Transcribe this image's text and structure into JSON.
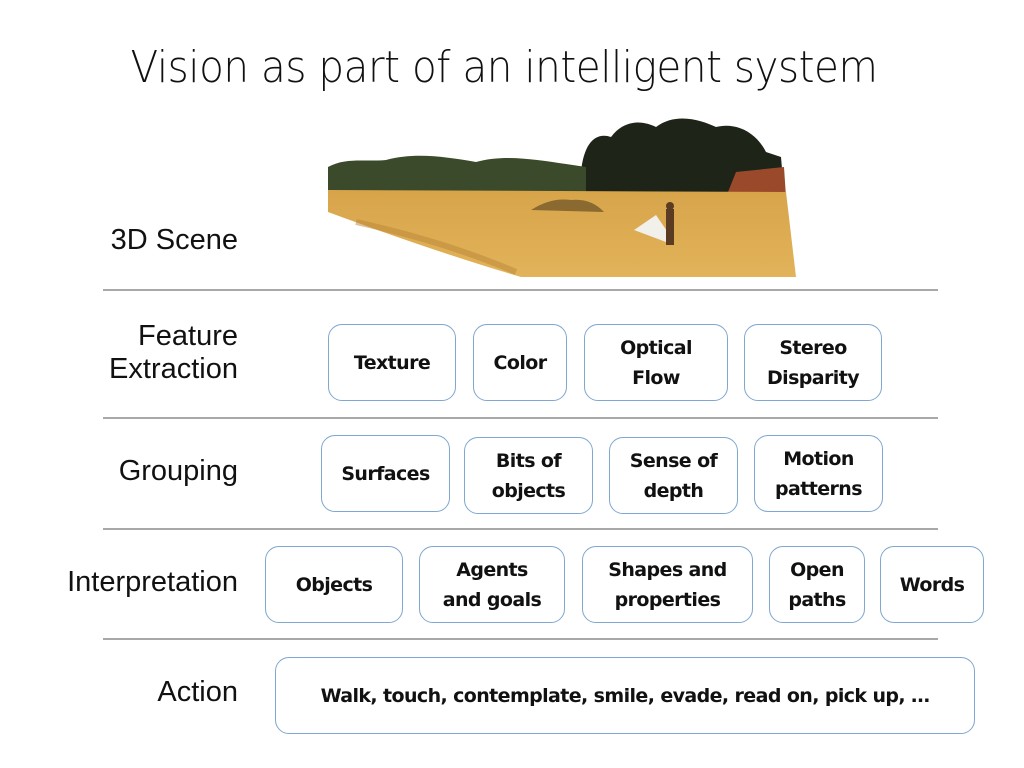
{
  "title": "Vision as part of an intelligent system",
  "layers": {
    "scene": {
      "label": "3D Scene",
      "image": "field-scene-with-trees-and-person"
    },
    "feature": {
      "label": "Feature\nExtraction",
      "items": [
        "Texture",
        "Color",
        "Optical\nFlow",
        "Stereo\nDisparity"
      ]
    },
    "grouping": {
      "label": "Grouping",
      "items": [
        "Surfaces",
        "Bits of\nobjects",
        "Sense of\ndepth",
        "Motion\npatterns"
      ]
    },
    "interpretation": {
      "label": "Interpretation",
      "items": [
        "Objects",
        "Agents\nand goals",
        "Shapes and\nproperties",
        "Open\npaths",
        "Words"
      ]
    },
    "action": {
      "label": "Action",
      "items": [
        "Walk, touch, contemplate, smile, evade, read on, pick up, …"
      ]
    }
  },
  "colors": {
    "box_border": "#7fa7cf",
    "divider": "#a8a8a8",
    "text": "#111111"
  }
}
